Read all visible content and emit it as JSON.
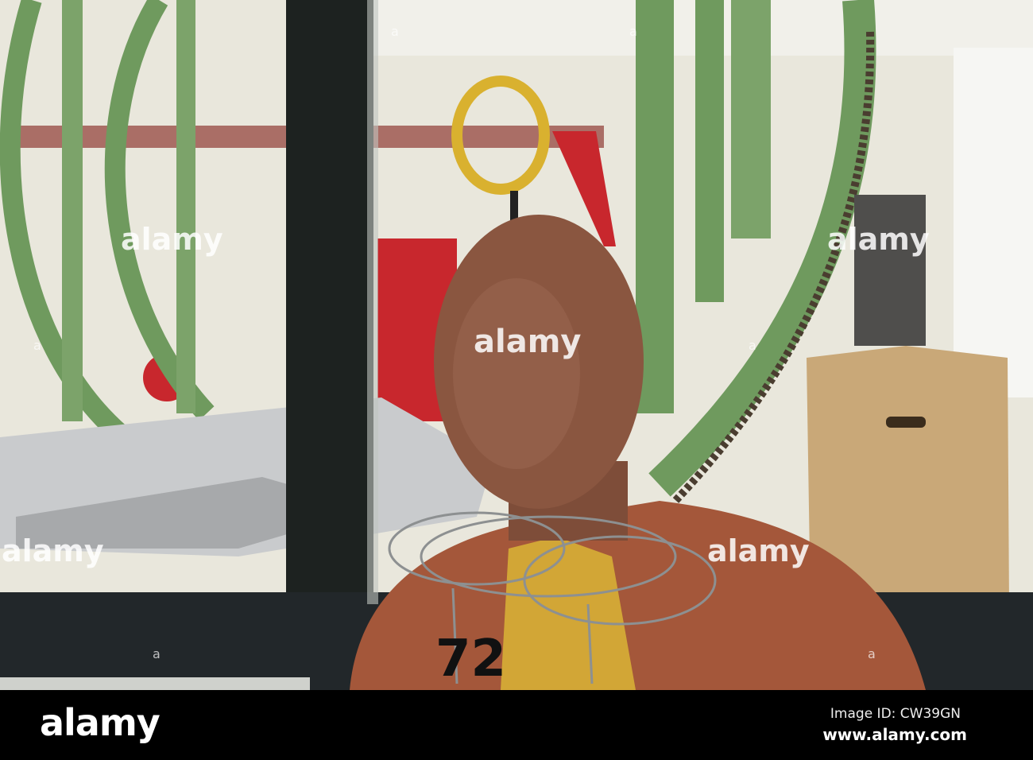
{
  "watermark": {
    "word": "alamy",
    "small_mark": "a"
  },
  "dummy": {
    "chest_number": "72"
  },
  "footer": {
    "logo": "alamy",
    "image_id": "Image ID: CW39GN",
    "url": "www.alamy.com"
  },
  "colors": {
    "background": "#e9e7dc",
    "green_frame": "#6f9a5e",
    "dummy_skin": "#8a5640",
    "dummy_torso": "#a4573a",
    "box": "#c9a878",
    "ring": "#d9b12f"
  }
}
